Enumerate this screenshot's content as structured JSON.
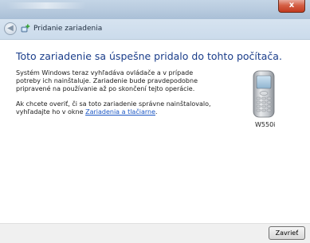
{
  "window": {
    "title": "",
    "close_glyph": "x",
    "close_icon": "close-icon"
  },
  "nav": {
    "back_glyph": "◀",
    "back_icon": "back-arrow-icon",
    "wizard_icon": "add-device-icon",
    "wizard_title": "Pridanie zariadenia"
  },
  "main": {
    "heading": "Toto zariadenie sa úspešne pridalo do tohto počítača.",
    "paragraph1": "Systém Windows teraz vyhľadáva ovládače a v prípade potreby ich nainštaluje. Zariadenie bude pravdepodobne pripravené na používanie až po skončení tejto operácie.",
    "paragraph2_text": "Ak chcete overiť, či sa toto zariadenie správne nainštalovalo, vyhľadajte ho v okne ",
    "paragraph2_link": "Zariadenia a tlačiarne",
    "paragraph2_end": ".",
    "device_icon": "mobile-phone-icon",
    "device_name": "W550i"
  },
  "footer": {
    "close_label": "Zavrieť"
  },
  "colors": {
    "heading": "#1a3d8a",
    "link": "#1a56c4",
    "close_button_red": "#c23a1f",
    "titlebar": "#b7cade"
  }
}
